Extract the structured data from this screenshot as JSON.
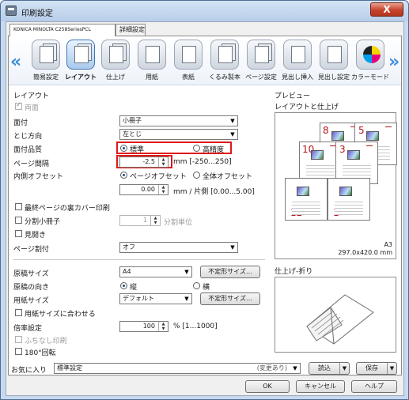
{
  "window": {
    "title": "印刷設定",
    "close": "X"
  },
  "tabs": [
    {
      "label": "KONICA MINOLTA C258SeriesPCL"
    },
    {
      "label": "詳細設定"
    }
  ],
  "iconbar": [
    {
      "label": "簡易設定",
      "icon": "quick-setup-icon"
    },
    {
      "label": "レイアウト",
      "icon": "layout-icon"
    },
    {
      "label": "仕上げ",
      "icon": "finishing-icon"
    },
    {
      "label": "用紙",
      "icon": "paper-icon"
    },
    {
      "label": "表紙",
      "icon": "cover-icon"
    },
    {
      "label": "くるみ製本",
      "icon": "perfect-binding-icon"
    },
    {
      "label": "ページ設定",
      "icon": "page-setup-icon"
    },
    {
      "label": "見出し挿入",
      "icon": "tab-insert-icon"
    },
    {
      "label": "見出し設定",
      "icon": "tab-setting-icon"
    },
    {
      "label": "カラーモード",
      "icon": "color-mode-icon"
    }
  ],
  "layout": {
    "section_title": "レイアウト",
    "duplex_label": "両面",
    "imposition": {
      "label": "面付",
      "value": "小冊子"
    },
    "binding": {
      "label": "とじ方向",
      "value": "左とじ"
    },
    "quality": {
      "label": "面付品質",
      "option1": "標準",
      "option2": "高精度"
    },
    "page_gap": {
      "label": "ページ間隔",
      "value": "-2.5",
      "unit": "mm [-250...250]"
    },
    "inner_offset": {
      "label": "内側オフセット",
      "option1": "ページオフセット",
      "option2": "全体オフセット",
      "value": "0.00",
      "unit": "mm / 片側 [0.00...5.00]"
    },
    "last_cover": "最終ページの裏カバー印刷",
    "split_booklet": {
      "label": "分割小冊子",
      "value": "1",
      "unit": "分割単位"
    },
    "spread": "見開き",
    "page_split": {
      "label": "ページ割付",
      "value": "オフ"
    }
  },
  "paper": {
    "original_size": {
      "label": "原稿サイズ",
      "value": "A4",
      "button": "不定形サイズ..."
    },
    "orientation": {
      "label": "原稿の向き",
      "option1": "縦",
      "option2": "横"
    },
    "paper_size": {
      "label": "用紙サイズ",
      "value": "デフォルト",
      "button": "不定形サイズ..."
    },
    "fit_to_paper": "用紙サイズに合わせる",
    "zoom": {
      "label": "倍率設定",
      "value": "100",
      "unit": "% [1...1000]"
    },
    "borderless": "ふちなし印刷",
    "rotate180": "180°回転"
  },
  "preview": {
    "title": "プレビュー",
    "subtitle": "レイアウトと仕上げ",
    "pages": [
      "8",
      "5",
      "10",
      "3",
      "12",
      "1"
    ],
    "paper_name": "A3",
    "paper_dims": "297.0x420.0 mm",
    "finish_title": "仕上げ-折り"
  },
  "favorites": {
    "label": "お気に入り",
    "value": "標準設定",
    "changed": "(変更あり)",
    "load": "読込",
    "save": "保存"
  },
  "footer": {
    "ok": "OK",
    "cancel": "キャンセル",
    "help": "ヘルプ"
  }
}
